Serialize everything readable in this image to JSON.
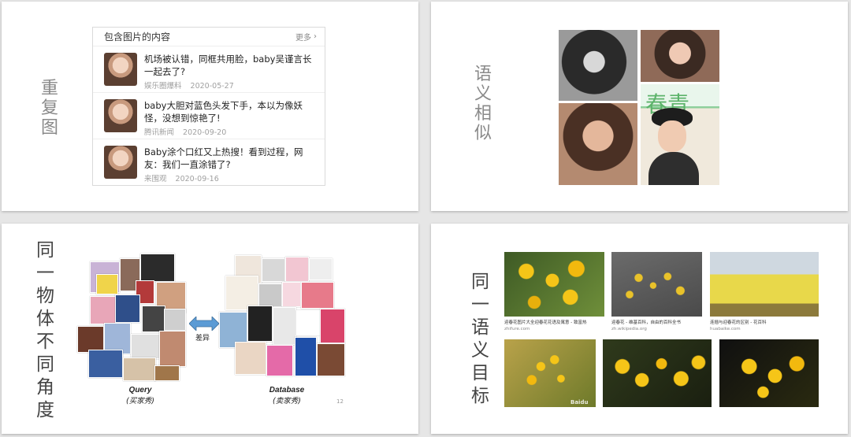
{
  "slides": {
    "repeat": {
      "title_chars": [
        "重",
        "复",
        "图"
      ],
      "card": {
        "header": "包含图片的内容",
        "more": "更多",
        "items": [
          {
            "title": "机场被认错，同框共用脸，baby吴谨言长一起去了?",
            "source": "娱乐圈爆料",
            "date": "2020-05-27"
          },
          {
            "title": "baby大胆对蓝色头发下手，本以为像妖怪，没想到惊艳了!",
            "source": "腾讯新闻",
            "date": "2020-09-20"
          },
          {
            "title": "Baby涂个口红又上热搜！看到过程，网友：我们一直涂错了?",
            "source": "来围观",
            "date": "2020-09-16"
          }
        ]
      }
    },
    "semantic": {
      "title_chars": [
        "语",
        "义",
        "相",
        "似"
      ],
      "cover_text": "春青"
    },
    "angle": {
      "title_chars": [
        "同",
        "一",
        "物",
        "体",
        "不",
        "同",
        "角",
        "度"
      ],
      "arrow_label": "差异",
      "query_label": "Query",
      "query_sub": "(买家秀)",
      "db_label": "Database",
      "db_sub": "(卖家秀)",
      "page_number": "12"
    },
    "target": {
      "title_chars": [
        "同",
        "一",
        "语",
        "义",
        "目",
        "标"
      ],
      "captions": [
        {
          "title": "迎春花图片大全迎春花花语及寓意 - 致富热",
          "source": "zhifure.com"
        },
        {
          "title": "迎春花 - 维基百科，自由的百科全书",
          "source": "zh.wikipedia.org"
        },
        {
          "title": "连翘与迎春花的区别 - 花百科",
          "source": "huabaike.com"
        }
      ],
      "watermark": "Baidu"
    }
  },
  "colors": {
    "title_gray": "#8a8a8a",
    "arrow_blue": "#5b9bd5",
    "flower_yellow": "#f5c518"
  }
}
